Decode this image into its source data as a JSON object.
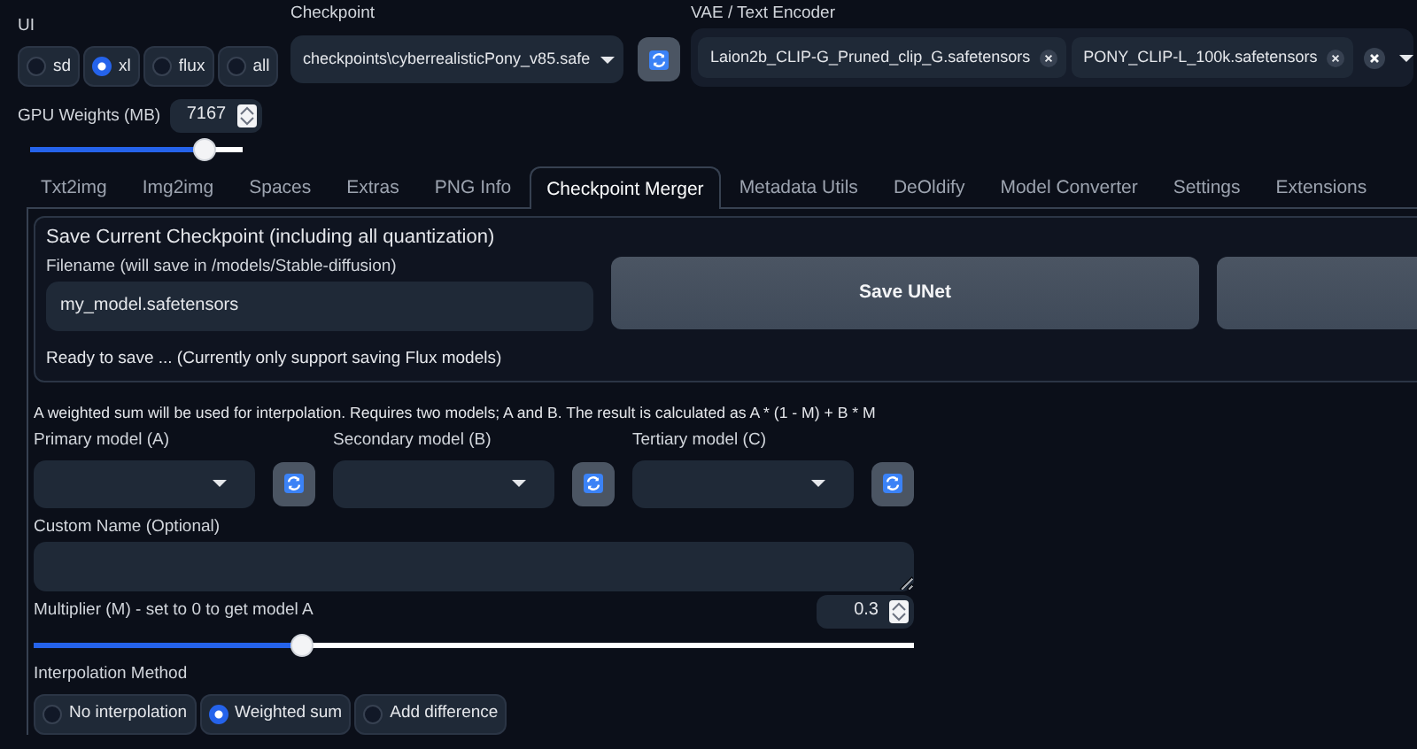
{
  "ui": {
    "label": "UI",
    "options": [
      {
        "label": "sd",
        "selected": false
      },
      {
        "label": "xl",
        "selected": true
      },
      {
        "label": "flux",
        "selected": false
      },
      {
        "label": "all",
        "selected": false
      }
    ]
  },
  "gpu_weights": {
    "label": "GPU Weights (MB)",
    "value": "7167",
    "level": 0.86
  },
  "checkpoint": {
    "label": "Checkpoint",
    "value": "checkpoints\\cyberrealisticPony_v85.safe"
  },
  "vae": {
    "label": "VAE / Text Encoder",
    "chips": [
      "Laion2b_CLIP-G_Pruned_clip_G.safetensors",
      "PONY_CLIP-L_100k.safetensors"
    ]
  },
  "tabs": [
    {
      "label": "Txt2img",
      "selected": false
    },
    {
      "label": "Img2img",
      "selected": false
    },
    {
      "label": "Spaces",
      "selected": false
    },
    {
      "label": "Extras",
      "selected": false
    },
    {
      "label": "PNG Info",
      "selected": false
    },
    {
      "label": "Checkpoint Merger",
      "selected": true
    },
    {
      "label": "Metadata Utils",
      "selected": false
    },
    {
      "label": "DeOldify",
      "selected": false
    },
    {
      "label": "Model Converter",
      "selected": false
    },
    {
      "label": "Settings",
      "selected": false
    },
    {
      "label": "Extensions",
      "selected": false
    }
  ],
  "save_section": {
    "title": "Save Current Checkpoint (including all quantization)",
    "filename_label": "Filename (will save in /models/Stable-diffusion)",
    "filename_value": "my_model.safetensors",
    "button": "Save UNet",
    "status": "Ready to save ... (Currently only support saving Flux models)"
  },
  "merge": {
    "description": "A weighted sum will be used for interpolation. Requires two models; A and B. The result is calculated as A * (1 - M) + B * M",
    "models": [
      {
        "label": "Primary model (A)"
      },
      {
        "label": "Secondary model (B)"
      },
      {
        "label": "Tertiary model (C)"
      }
    ],
    "custom_name": {
      "label": "Custom Name (Optional)"
    },
    "multiplier": {
      "label": "Multiplier (M) - set to 0 to get model A",
      "value": "0.3",
      "level": 0.3
    },
    "interpolation": {
      "label": "Interpolation Method",
      "options": [
        {
          "label": "No interpolation",
          "selected": false
        },
        {
          "label": "Weighted sum",
          "selected": true
        },
        {
          "label": "Add difference",
          "selected": false
        }
      ]
    }
  }
}
